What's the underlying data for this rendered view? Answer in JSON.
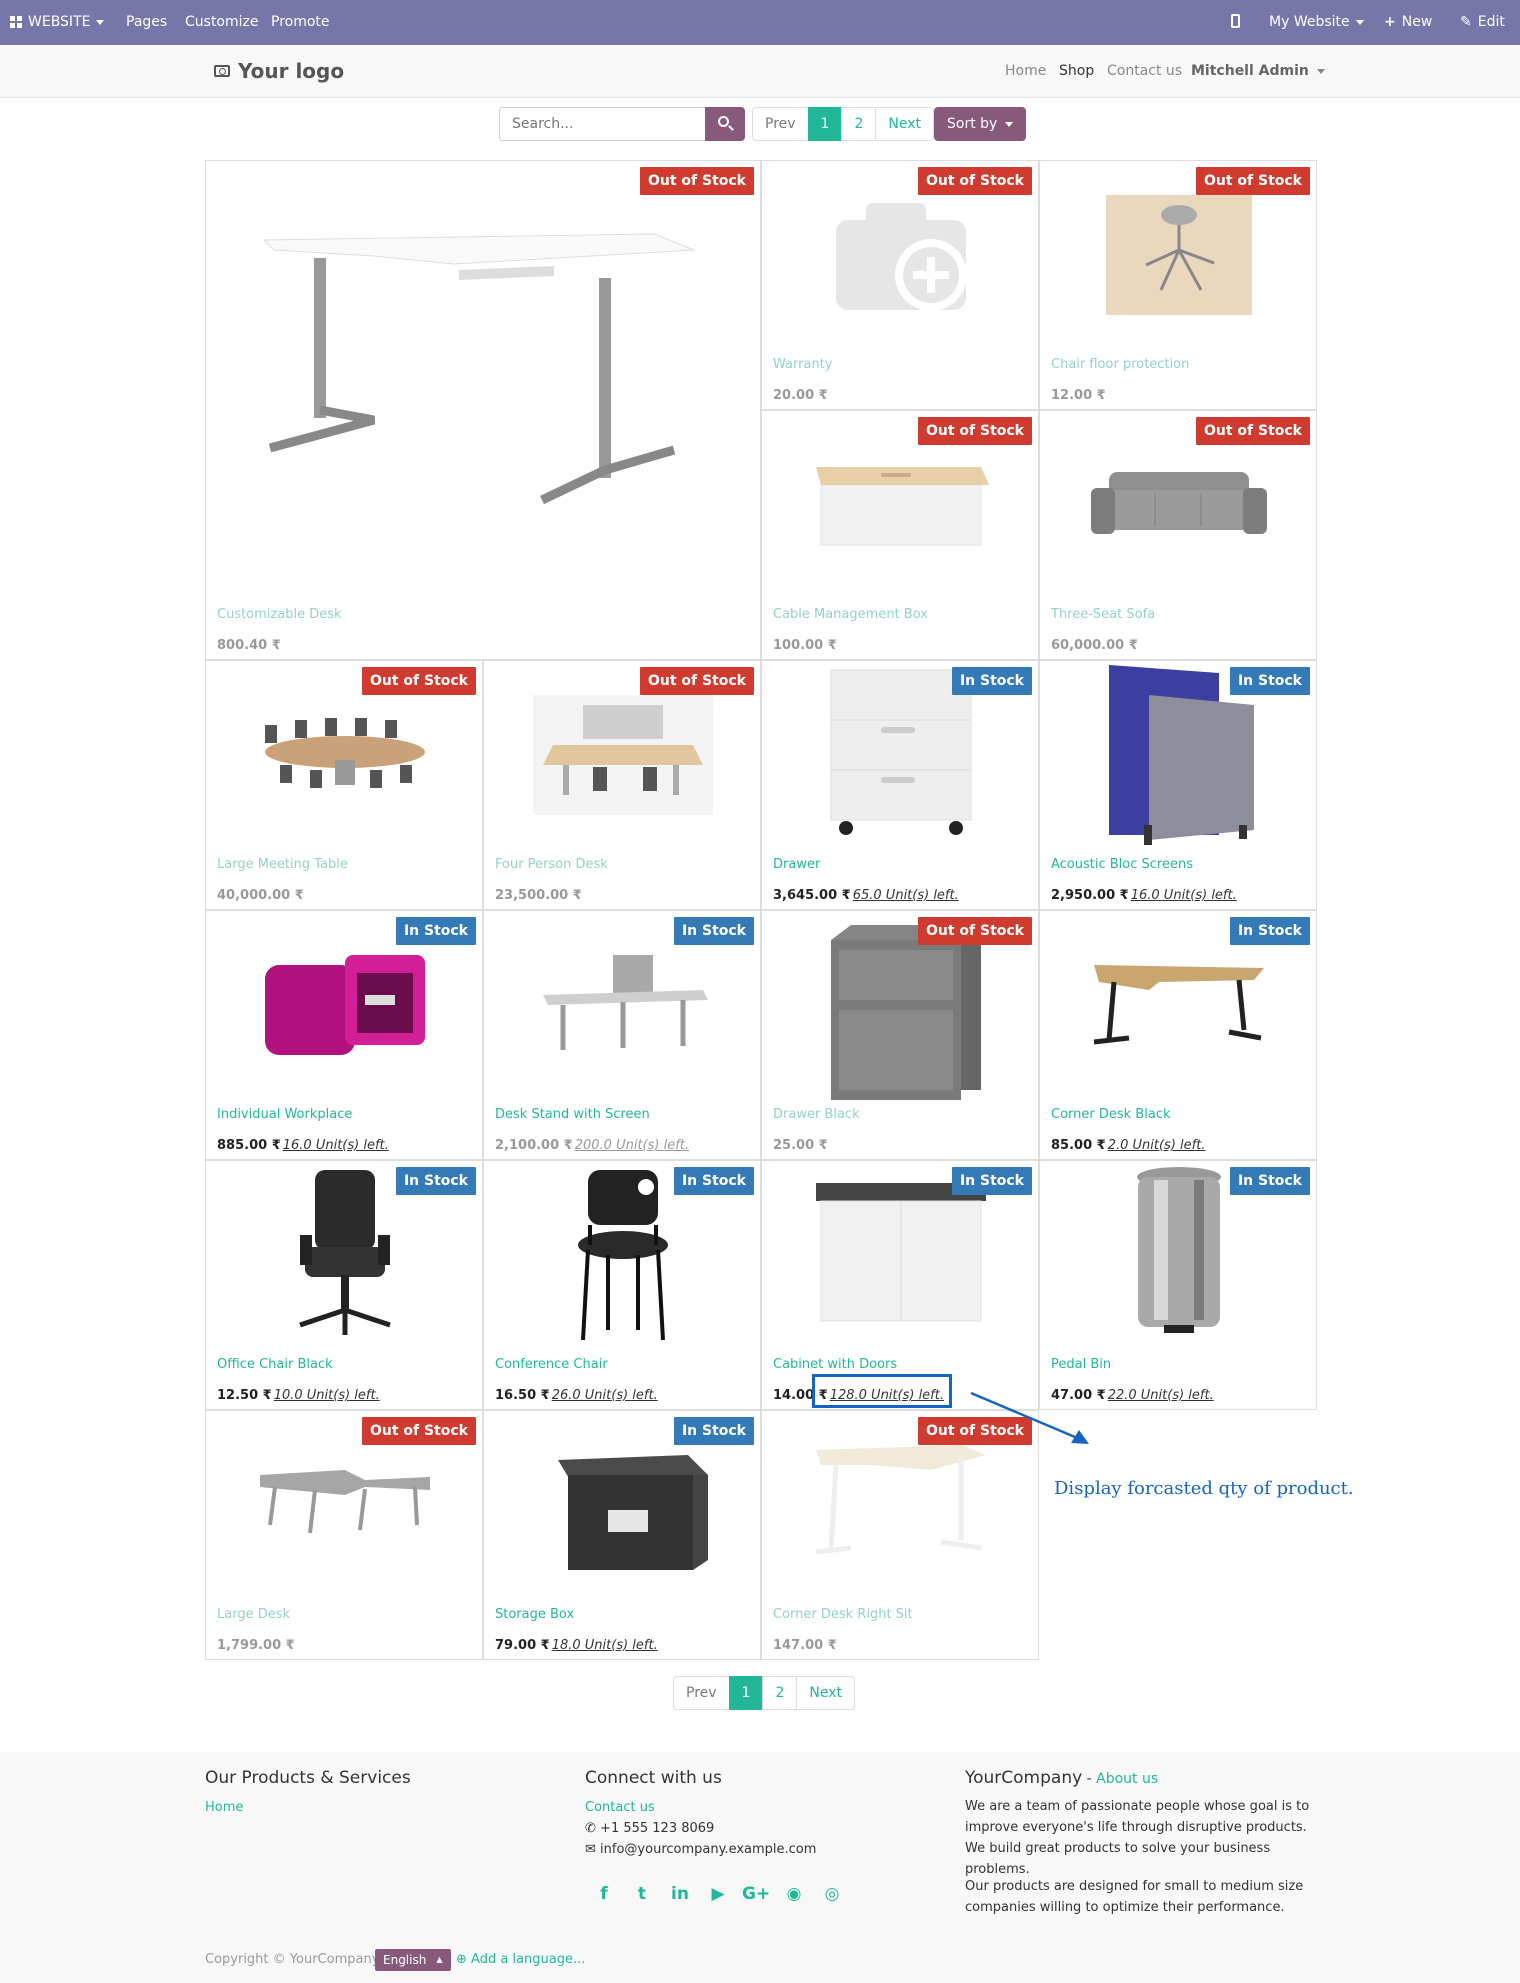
{
  "adminbar": {
    "website_label": "WEBSITE",
    "pages_label": "Pages",
    "customize_label": "Customize",
    "promote_label": "Promote",
    "my_website_label": "My Website",
    "new_label": "New",
    "edit_label": "Edit"
  },
  "header": {
    "logo_text": "Your logo",
    "nav": [
      "Home",
      "Shop",
      "Contact us"
    ],
    "user": "Mitchell Admin"
  },
  "search": {
    "placeholder": "Search..."
  },
  "pager": {
    "prev": "Prev",
    "pages": [
      "1",
      "2"
    ],
    "next": "Next",
    "current": "1"
  },
  "sort_label": "Sort by",
  "colors": {
    "brand": "#7676a8",
    "accent": "#875a7b",
    "link": "#21b799",
    "out_of_stock": "#d03b2f",
    "in_stock": "#337ab7",
    "annotation": "#1565c0"
  },
  "products": [
    {
      "name": "Customizable Desk",
      "price": "800.40 ₹",
      "units": "",
      "badge": "Out of Stock",
      "img": "desk"
    },
    {
      "name": "Warranty",
      "price": "20.00 ₹",
      "units": "",
      "badge": "Out of Stock",
      "img": "camera"
    },
    {
      "name": "Chair floor protection",
      "price": "12.00 ₹",
      "units": "",
      "badge": "Out of Stock",
      "img": "floor"
    },
    {
      "name": "Cable Management Box",
      "price": "100.00 ₹",
      "units": "",
      "badge": "Out of Stock",
      "img": "cablebox"
    },
    {
      "name": "Three-Seat Sofa",
      "price": "60,000.00 ₹",
      "units": "",
      "badge": "Out of Stock",
      "img": "sofa"
    },
    {
      "name": "Large Meeting Table",
      "price": "40,000.00 ₹",
      "units": "",
      "badge": "Out of Stock",
      "img": "meeting"
    },
    {
      "name": "Four Person Desk",
      "price": "23,500.00 ₹",
      "units": "",
      "badge": "Out of Stock",
      "img": "fourdesk"
    },
    {
      "name": "Drawer",
      "price": "3,645.00 ₹",
      "units": "65.0 Unit(s) left.",
      "badge": "In Stock",
      "img": "drawer"
    },
    {
      "name": "Acoustic Bloc Screens",
      "price": "2,950.00 ₹",
      "units": "16.0 Unit(s) left.",
      "badge": "In Stock",
      "img": "screens"
    },
    {
      "name": "Individual Workplace",
      "price": "885.00 ₹",
      "units": "16.0 Unit(s) left.",
      "badge": "In Stock",
      "img": "workplace"
    },
    {
      "name": "Desk Stand with Screen",
      "price": "2,100.00 ₹",
      "units": "200.0 Unit(s) left.",
      "badge": "In Stock",
      "img": "deskstand"
    },
    {
      "name": "Drawer Black",
      "price": "25.00 ₹",
      "units": "",
      "badge": "Out of Stock",
      "img": "drawerblack"
    },
    {
      "name": "Corner Desk Black",
      "price": "85.00 ₹",
      "units": "2.0 Unit(s) left.",
      "badge": "In Stock",
      "img": "cornerdesk"
    },
    {
      "name": "Office Chair Black",
      "price": "12.50 ₹",
      "units": "10.0 Unit(s) left.",
      "badge": "In Stock",
      "img": "officechair"
    },
    {
      "name": "Conference Chair",
      "price": "16.50 ₹",
      "units": "26.0 Unit(s) left.",
      "badge": "In Stock",
      "img": "confchair"
    },
    {
      "name": "Cabinet with Doors",
      "price": "14.00 ₹",
      "units": "128.0 Unit(s) left.",
      "badge": "In Stock",
      "img": "cabinet"
    },
    {
      "name": "Pedal Bin",
      "price": "47.00 ₹",
      "units": "22.0 Unit(s) left.",
      "badge": "In Stock",
      "img": "bin"
    },
    {
      "name": "Large Desk",
      "price": "1,799.00 ₹",
      "units": "",
      "badge": "Out of Stock",
      "img": "largedesk"
    },
    {
      "name": "Storage Box",
      "price": "79.00 ₹",
      "units": "18.0 Unit(s) left.",
      "badge": "In Stock",
      "img": "storagebox"
    },
    {
      "name": "Corner Desk Right Sit",
      "price": "147.00 ₹",
      "units": "",
      "badge": "Out of Stock",
      "img": "cornerright"
    }
  ],
  "annotation": "Display forcasted qty of product.",
  "footer": {
    "col1_title": "Our Products & Services",
    "col1_link": "Home",
    "col2_title": "Connect with us",
    "contact_link": "Contact us",
    "phone": "+1 555 123 8069",
    "email": "info@yourcompany.example.com",
    "company": "YourCompany",
    "company_sep": " - ",
    "about_link": "About us",
    "para1": "We are a team of passionate people whose goal is to improve everyone's life through disruptive products. We build great products to solve your business problems.",
    "para2": "Our products are designed for small to medium size companies willing to optimize their performance.",
    "copyright": "Copyright © YourCompany",
    "language": "English",
    "add_language": "Add a language..."
  }
}
